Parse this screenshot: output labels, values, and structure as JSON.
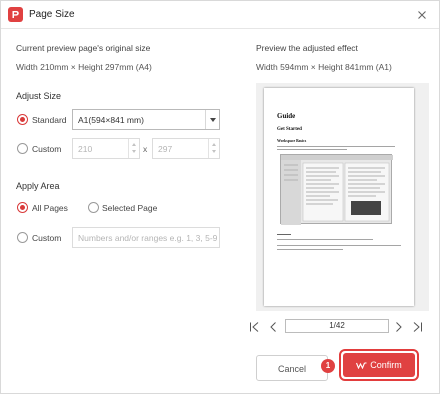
{
  "window": {
    "title": "Page Size",
    "close_icon": "close-icon",
    "logo_icon": "app-logo-icon"
  },
  "original": {
    "label": "Current preview page's original size",
    "size_text": "Width 210mm × Height 297mm (A4)"
  },
  "adjust_size": {
    "section_title": "Adjust Size",
    "standard": {
      "label": "Standard",
      "checked": true,
      "selected_value": "A1(594×841 mm)"
    },
    "custom": {
      "label": "Custom",
      "checked": false,
      "width_value": "210",
      "height_value": "297",
      "separator": "x"
    }
  },
  "apply_area": {
    "section_title": "Apply Area",
    "all_pages": {
      "label": "All Pages",
      "checked": true
    },
    "selected_page": {
      "label": "Selected Page",
      "checked": false
    },
    "custom": {
      "label": "Custom",
      "checked": false,
      "placeholder": "Numbers and/or ranges e.g. 1, 3, 5-9"
    }
  },
  "preview": {
    "label": "Preview the adjusted effect",
    "size_text": "Width 594mm × Height 841mm (A1)",
    "document": {
      "title": "Guide",
      "heading": "Get Started",
      "subheading": "Workspace Basics"
    }
  },
  "pagination": {
    "current_display": "1/42"
  },
  "buttons": {
    "cancel": "Cancel",
    "confirm": "Confirm"
  },
  "annotation": {
    "step_number": "1"
  },
  "colors": {
    "accent": "#e04141",
    "border": "#cfcfcf",
    "text": "#333333"
  }
}
